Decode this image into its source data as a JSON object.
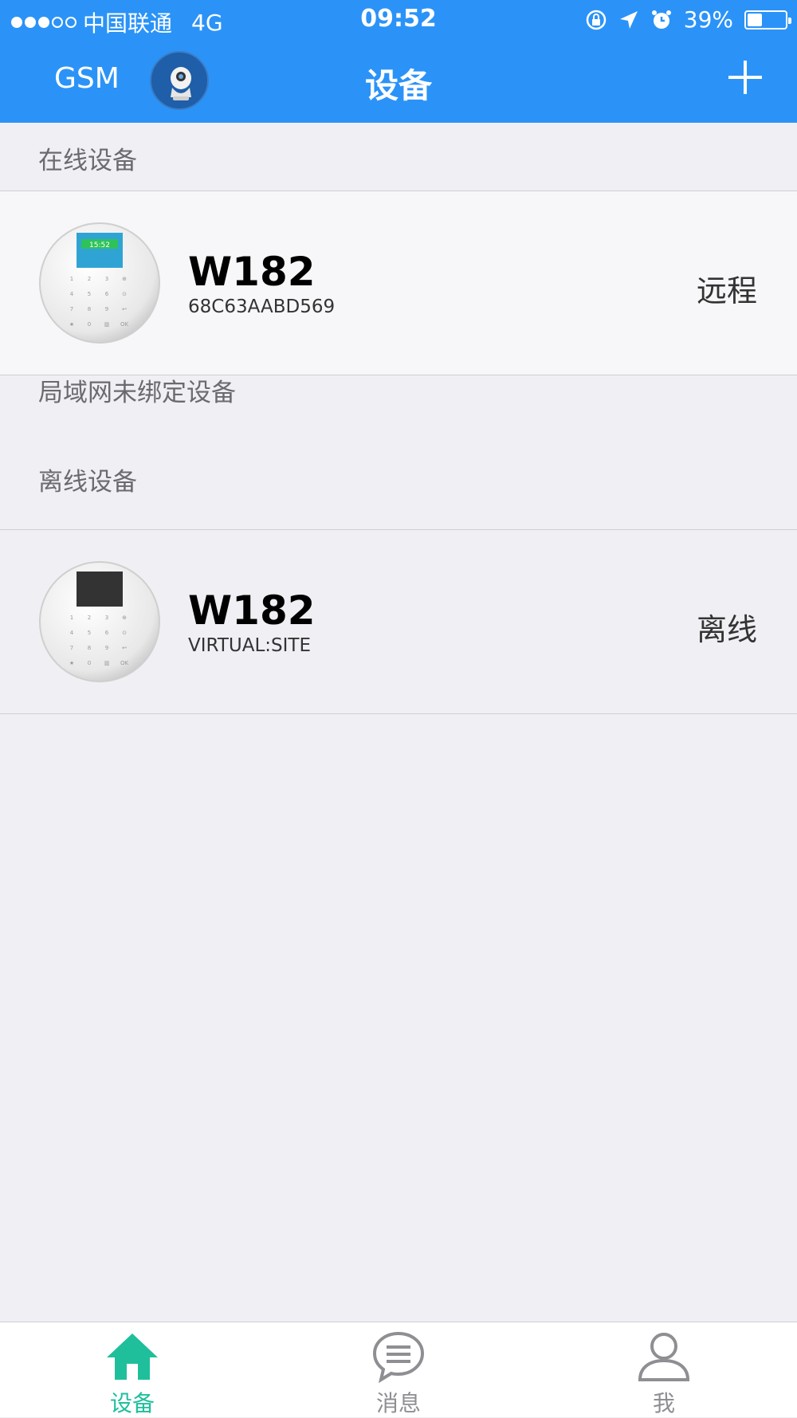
{
  "status_bar": {
    "signal_filled": 3,
    "signal_total": 5,
    "carrier": "中国联通",
    "network": "4G",
    "time": "09:52",
    "battery": "39%",
    "battery_level": 0.39,
    "icons": [
      "orientation-lock-icon",
      "location-arrow-icon",
      "alarm-icon"
    ]
  },
  "nav": {
    "left_label": "GSM",
    "title": "设备",
    "avatar_icon": "camera-avatar-icon",
    "add_icon": "plus-icon"
  },
  "sections": {
    "online": "在线设备",
    "lan_unbound": "局域网未绑定设备",
    "offline": "离线设备"
  },
  "devices": [
    {
      "name": "W182",
      "id": "68C63AABD569",
      "status": "远程",
      "screen_time": "15:52",
      "screen_color": "#2fa4d4"
    },
    {
      "name": "W182",
      "id": "VIRTUAL:SITE",
      "status": "离线",
      "screen_color": "#333333"
    }
  ],
  "tabs": [
    {
      "label": "设备",
      "icon": "home-icon",
      "active": true
    },
    {
      "label": "消息",
      "icon": "message-icon",
      "active": false
    },
    {
      "label": "我",
      "icon": "profile-icon",
      "active": false
    }
  ],
  "colors": {
    "primary": "#2b93f7",
    "active_tab": "#1fbf9c",
    "inactive_tab": "#8e8e93",
    "background": "#efeff4"
  }
}
